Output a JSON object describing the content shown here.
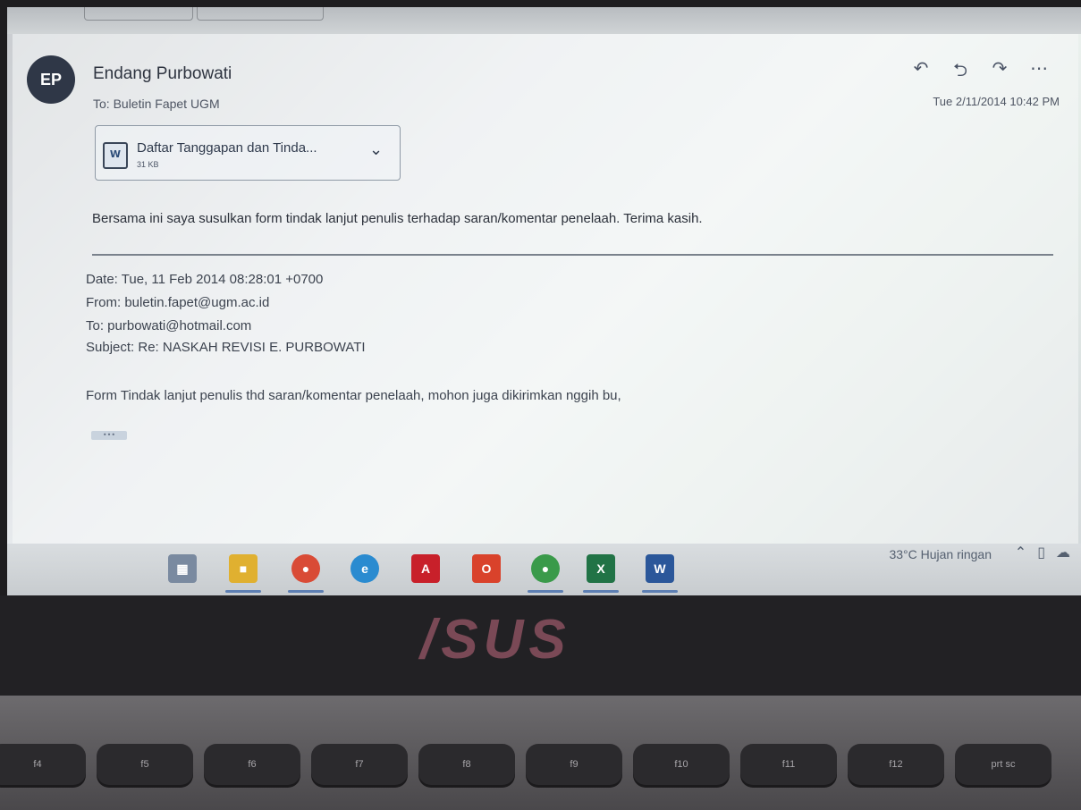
{
  "email": {
    "avatar_initials": "EP",
    "sender_name": "Endang Purbowati",
    "to_line": "To:  Buletin Fapet UGM",
    "received": "Tue 2/11/2014 10:42 PM",
    "actions": {
      "reply_icon": "reply-icon",
      "reply_all_icon": "reply-all-icon",
      "forward_icon": "forward-icon",
      "more_icon": "more-icon"
    },
    "attachment": {
      "name": "Daftar Tanggapan dan Tinda...",
      "size": "31 KB",
      "icon": "word-document-icon"
    },
    "body": "Bersama ini saya susulkan form tindak lanjut penulis terhadap saran/komentar penelaah. Terima kasih.",
    "quoted": {
      "date": "Date: Tue, 11 Feb 2014 08:28:01 +0700",
      "from": "From: buletin.fapet@ugm.ac.id",
      "to": "To: purbowati@hotmail.com",
      "subject": "Subject: Re: NASKAH REVISI E. PURBOWATI",
      "body": "Form Tindak lanjut penulis thd saran/komentar penelaah, mohon juga dikirimkan nggih bu,",
      "ellipsis": "•••"
    }
  },
  "taskbar": {
    "apps": [
      {
        "name": "task-view",
        "label": "▦",
        "color": "#7a8aa0"
      },
      {
        "name": "file-explorer",
        "label": "■",
        "color": "#e0b030"
      },
      {
        "name": "chrome",
        "label": "●",
        "color": "#d94b36"
      },
      {
        "name": "edge",
        "label": "e",
        "color": "#2a8bd0"
      },
      {
        "name": "acrobat",
        "label": "A",
        "color": "#c8202a"
      },
      {
        "name": "office",
        "label": "O",
        "color": "#d9422b"
      },
      {
        "name": "app-green-red",
        "label": "●",
        "color": "#3a9a4a"
      },
      {
        "name": "excel",
        "label": "X",
        "color": "#217346"
      },
      {
        "name": "word",
        "label": "W",
        "color": "#2b579a"
      }
    ],
    "weather": "33°C  Hujan ringan",
    "tray": {
      "chevron": "⌃",
      "network": "▯",
      "onedrive": "☁"
    }
  },
  "laptop": {
    "logo": "/SUS",
    "keys": [
      "f4",
      "f5",
      "f6",
      "f7",
      "f8",
      "f9",
      "f10",
      "f11",
      "f12",
      "prt sc"
    ]
  }
}
